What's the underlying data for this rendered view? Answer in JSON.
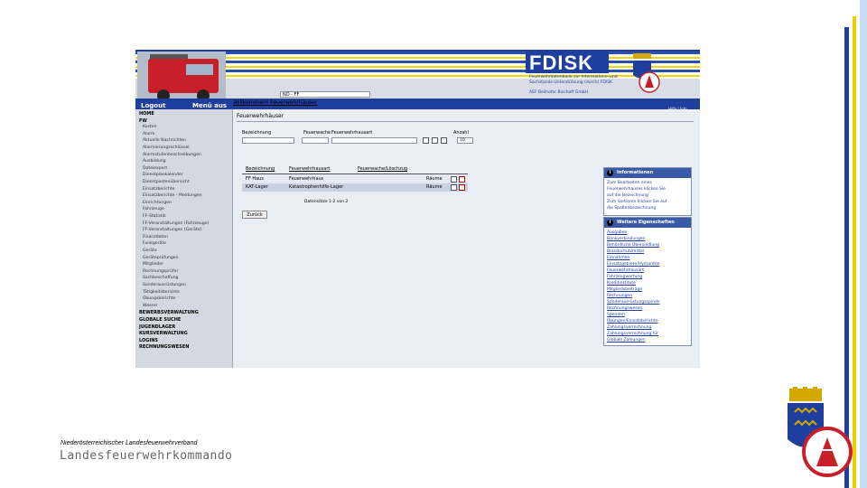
{
  "header": {
    "brand": "FDISK",
    "subtitle": "Feuerwehrdatenbank zur Informations- und Sachstands-Unterstützung (durch) FDISK",
    "company": "AEF Beilhofer Bischoff GmbH",
    "logout_label": "Logout",
    "menu_label": "Menü aus",
    "welcome_text": "Willkommen! Feuerwehrhäuser",
    "org_select_value": "NÖ - FF",
    "help_label": "Hilfe | Info"
  },
  "sidebar": {
    "items": [
      {
        "label": "HOME",
        "bold": true
      },
      {
        "label": "FW",
        "bold": true
      },
      {
        "label": "Kosten"
      },
      {
        "label": "Alarm"
      },
      {
        "label": "Aktuelle Nachrichten"
      },
      {
        "label": "Alarmierungsschlüssel"
      },
      {
        "label": "Alarmstufenbeschreibungen"
      },
      {
        "label": "Ausbildung"
      },
      {
        "label": "Dateiexport"
      },
      {
        "label": "Dienstplankalender"
      },
      {
        "label": "Dienstpostenübersicht"
      },
      {
        "label": "Einsatzberichte"
      },
      {
        "label": "Einsatzberichte - Meldungen"
      },
      {
        "label": "Einrichtungen"
      },
      {
        "label": "Fahrzeuge"
      },
      {
        "label": "FF-Statistik"
      },
      {
        "label": "FF-Veranstaltungen (Fahrzeuge)"
      },
      {
        "label": "FF-Veranstaltungen (Geräte)"
      },
      {
        "label": "Finanzdaten"
      },
      {
        "label": "Funkgeräte"
      },
      {
        "label": "Geräte"
      },
      {
        "label": "Geräteprüfungen"
      },
      {
        "label": "Mitglieder"
      },
      {
        "label": "Rechnungsprüfer"
      },
      {
        "label": "Sachbeschaffung"
      },
      {
        "label": "Sonderausrüstungen"
      },
      {
        "label": "Tätigkeitsberichte"
      },
      {
        "label": "Übungsberichte"
      },
      {
        "label": "Wasser"
      },
      {
        "label": "BEWERBSVERWALTUNG",
        "bold": true
      },
      {
        "label": "GLOBALE SUCHE",
        "bold": true
      },
      {
        "label": "JUGENDLAGER",
        "bold": true
      },
      {
        "label": "KURSVERWALTUNG",
        "bold": true
      },
      {
        "label": "LOGINS",
        "bold": true
      },
      {
        "label": "RECHNUNGSWESEN",
        "bold": true
      }
    ]
  },
  "main": {
    "title": "Feuerwehrhäuser",
    "filters": {
      "bezeichnung_label": "Bezeichnung",
      "feuerwache_label": "Feuerwache",
      "haustyp_label": "Feuerwehrhausart",
      "anzahl_label": "Anzahl",
      "anzahl_value": "10"
    },
    "table": {
      "headers": [
        "Bezeichnung",
        "Feuerwehrhausart",
        "Feuerwache/Löschzug"
      ],
      "rows": [
        {
          "bezeichnung": "FF Haus",
          "art": "Feuerwehrhaus",
          "action": "Räume"
        },
        {
          "bezeichnung": "KAT-Lager",
          "art": "Katastrophenhilfe-Lager",
          "action": "Räume"
        }
      ]
    },
    "pager": "Datensätze 1-2 von 2",
    "back_label": "Zurück"
  },
  "info_box": {
    "title": "Informationen",
    "items": [
      "Zum Bearbeiten eines",
      "Feuerwehrhauses klicken Sie",
      "auf die Bezeichnung",
      "Zum Sortieren klicken Sie auf",
      "die Spaltenbezeichnung"
    ]
  },
  "props_box": {
    "title": "Weitere Eigenschaften",
    "items": [
      "Ausgaben",
      "Bankverbindungen",
      "Behördliche Übersiedlung",
      "Brandschutzmittel",
      "Einnahmen",
      "Einsatzgebiete/Hydranten",
      "Feuerwehrhausart",
      "Fahrzeugwartung",
      "Kreditinstitute",
      "Mitgliedsbeiträge",
      "Rechnungen",
      "Sonderausrüstungsspinde",
      "Rechnungswesen",
      "Spenden",
      "Übungen/Einsatzberichte",
      "Zahlungsverrechnung",
      "Zahlungsverrechnung für",
      "Globale Zahlungen"
    ]
  },
  "footer": {
    "association": "Niederösterreichischer Landesfeuerwehrverband",
    "command": "Landesfeuerwehrkommando"
  },
  "colors": {
    "brand_blue": "#1f3f9e",
    "accent_yellow": "#f2d600",
    "emblem_red": "#c8202a"
  }
}
